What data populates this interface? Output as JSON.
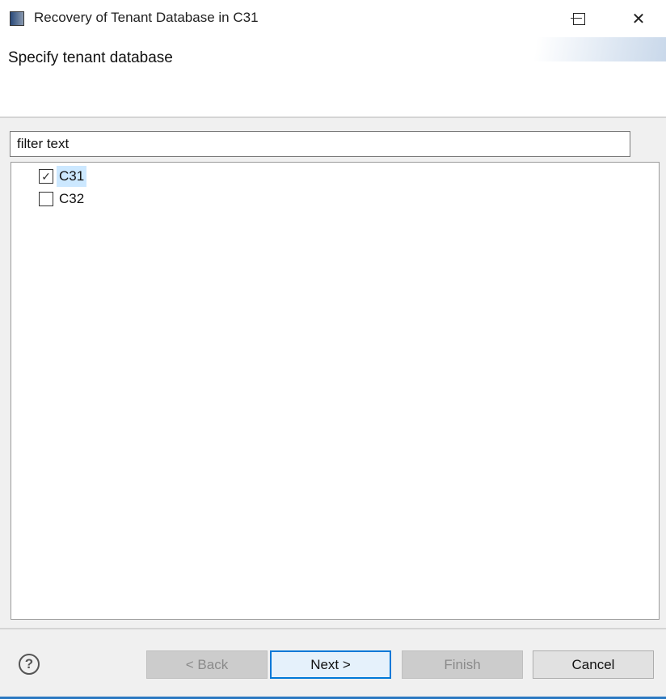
{
  "window": {
    "title": "Recovery of Tenant Database in C31",
    "minimize": "—",
    "maximize": "☐",
    "close": "✕"
  },
  "header": {
    "title": "Specify tenant database"
  },
  "filter": {
    "value": "filter text"
  },
  "tree": {
    "items": [
      {
        "label": "C31",
        "checked": true,
        "selected": true
      },
      {
        "label": "C32",
        "checked": false,
        "selected": false
      }
    ]
  },
  "buttons": {
    "help": "?",
    "back": "< Back",
    "next": "Next >",
    "finish": "Finish",
    "cancel": "Cancel"
  },
  "colors": {
    "accent": "#0078d7",
    "selection": "#cce8ff"
  }
}
